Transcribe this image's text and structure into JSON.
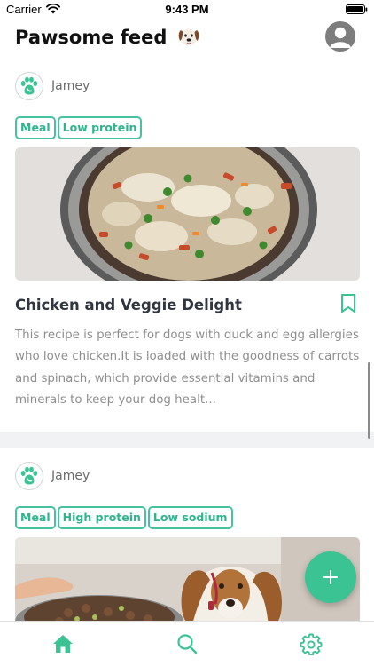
{
  "status_bar": {
    "carrier": "Carrier",
    "time": "9:43 PM"
  },
  "header": {
    "title": "Pawsome feed",
    "title_emoji_icon": "dog-face-icon",
    "profile_icon": "user-avatar-icon"
  },
  "posts": [
    {
      "author": "Jamey",
      "avatar_icon": "paw-icon",
      "tags": [
        "Meal",
        "Low protein"
      ],
      "image": "bowl-of-chicken-rice-peas-carrots",
      "title": "Chicken and Veggie Delight",
      "description": "This recipe is perfect for dogs with duck and egg allergies who love chicken.It is loaded with the goodness of carrots and spinach, which provide essential vitamins and minerals to keep your dog healt...",
      "bookmark_icon": "bookmark-icon"
    },
    {
      "author": "Jamey",
      "avatar_icon": "paw-icon",
      "tags": [
        "Meal",
        "High protein",
        "Low sodium"
      ],
      "image": "dog-looking-at-food-bowl"
    }
  ],
  "fab": {
    "icon": "plus-icon"
  },
  "tab_bar": {
    "items": [
      {
        "name": "home",
        "icon": "home-icon",
        "active": true
      },
      {
        "name": "search",
        "icon": "search-icon",
        "active": false
      },
      {
        "name": "settings",
        "icon": "gear-icon",
        "active": false
      }
    ]
  },
  "colors": {
    "accent": "#3cc394",
    "tag_border": "#47c2a0",
    "text_dark": "#2f3640",
    "text_muted": "#8e8e8e",
    "divider": "#f1f2f4"
  }
}
